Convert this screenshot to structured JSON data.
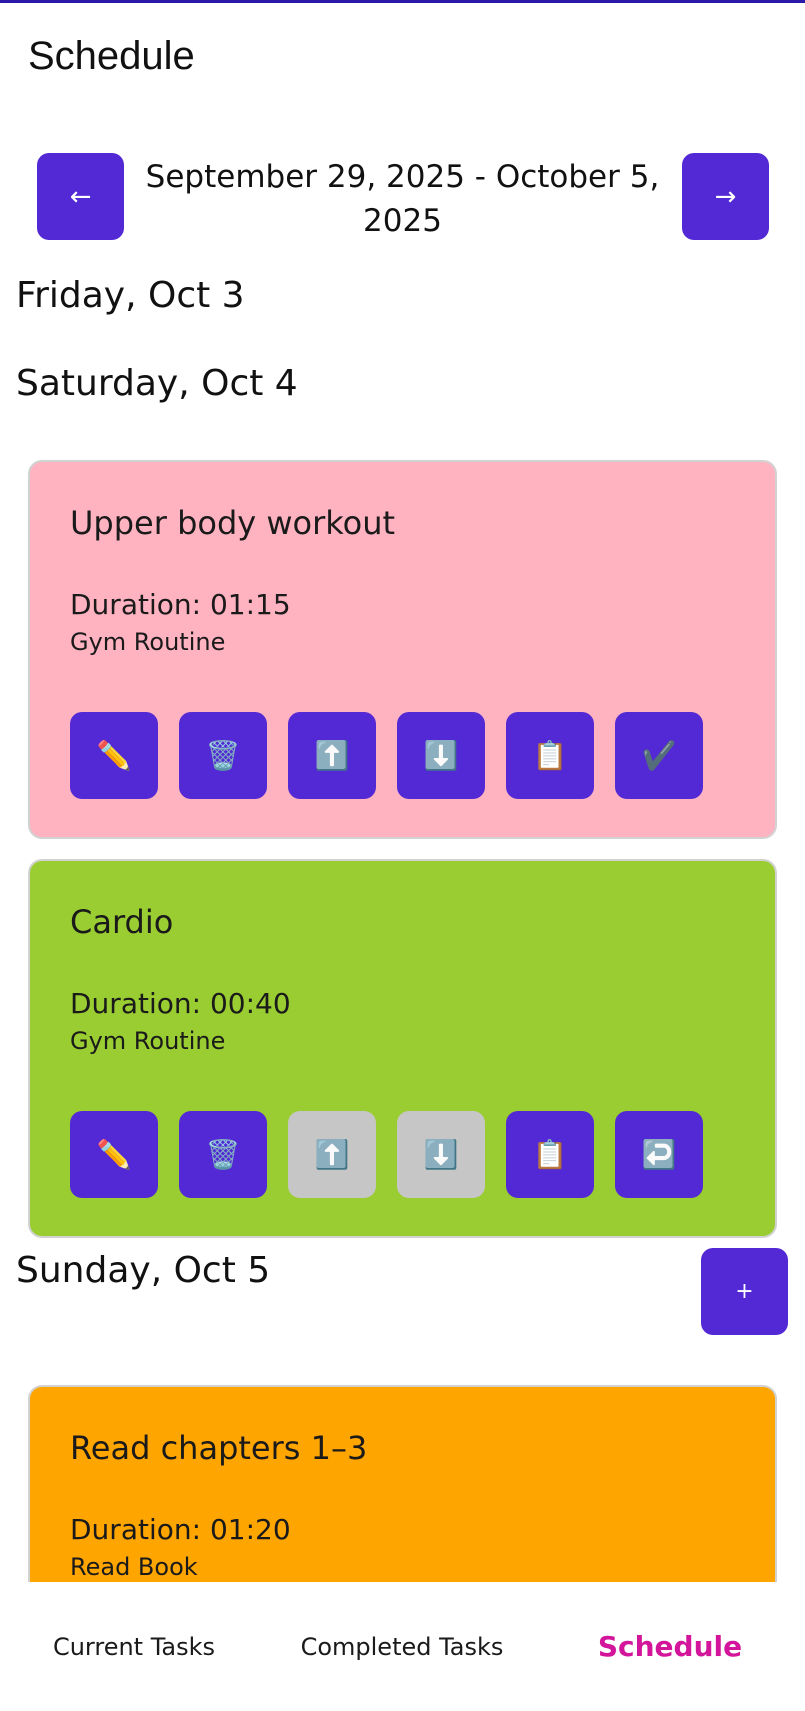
{
  "header": {
    "title": "Schedule"
  },
  "week": {
    "prev_label": "←",
    "next_label": "→",
    "range": "September 29, 2025 - October 5, 2025"
  },
  "days": {
    "friday": "Friday, Oct 3",
    "saturday": "Saturday, Oct 4",
    "sunday": "Sunday, Oct 5"
  },
  "tasks": [
    {
      "title": "Upper body workout",
      "duration": "Duration: 01:15",
      "routine": "Gym Routine",
      "color": "#ffb3c1",
      "actions": [
        {
          "icon": "✏️",
          "name": "edit-icon",
          "enabled": true
        },
        {
          "icon": "🗑️",
          "name": "trash-icon",
          "enabled": true
        },
        {
          "icon": "⬆️",
          "name": "arrow-up-icon",
          "enabled": true
        },
        {
          "icon": "⬇️",
          "name": "arrow-down-icon",
          "enabled": true
        },
        {
          "icon": "📋",
          "name": "clipboard-icon",
          "enabled": true
        },
        {
          "icon": "✔️",
          "name": "checkmark-icon",
          "enabled": true
        }
      ]
    },
    {
      "title": "Cardio",
      "duration": "Duration: 00:40",
      "routine": "Gym Routine",
      "color": "#9acd32",
      "actions": [
        {
          "icon": "✏️",
          "name": "edit-icon",
          "enabled": true
        },
        {
          "icon": "🗑️",
          "name": "trash-icon",
          "enabled": true
        },
        {
          "icon": "⬆️",
          "name": "arrow-up-icon",
          "enabled": false
        },
        {
          "icon": "⬇️",
          "name": "arrow-down-icon",
          "enabled": false
        },
        {
          "icon": "📋",
          "name": "clipboard-icon",
          "enabled": true
        },
        {
          "icon": "↩️",
          "name": "undo-icon",
          "enabled": true
        }
      ]
    },
    {
      "title": "Read chapters 1–3",
      "duration": "Duration: 01:20",
      "routine": "Read Book",
      "color": "#ffa500"
    }
  ],
  "fab": {
    "label": "+"
  },
  "bottom_nav": {
    "current": "Current Tasks",
    "completed": "Completed Tasks",
    "schedule": "Schedule"
  },
  "colors": {
    "accent": "#5229d4",
    "active_tab": "#d2159a",
    "disabled": "#c6c6c6"
  }
}
